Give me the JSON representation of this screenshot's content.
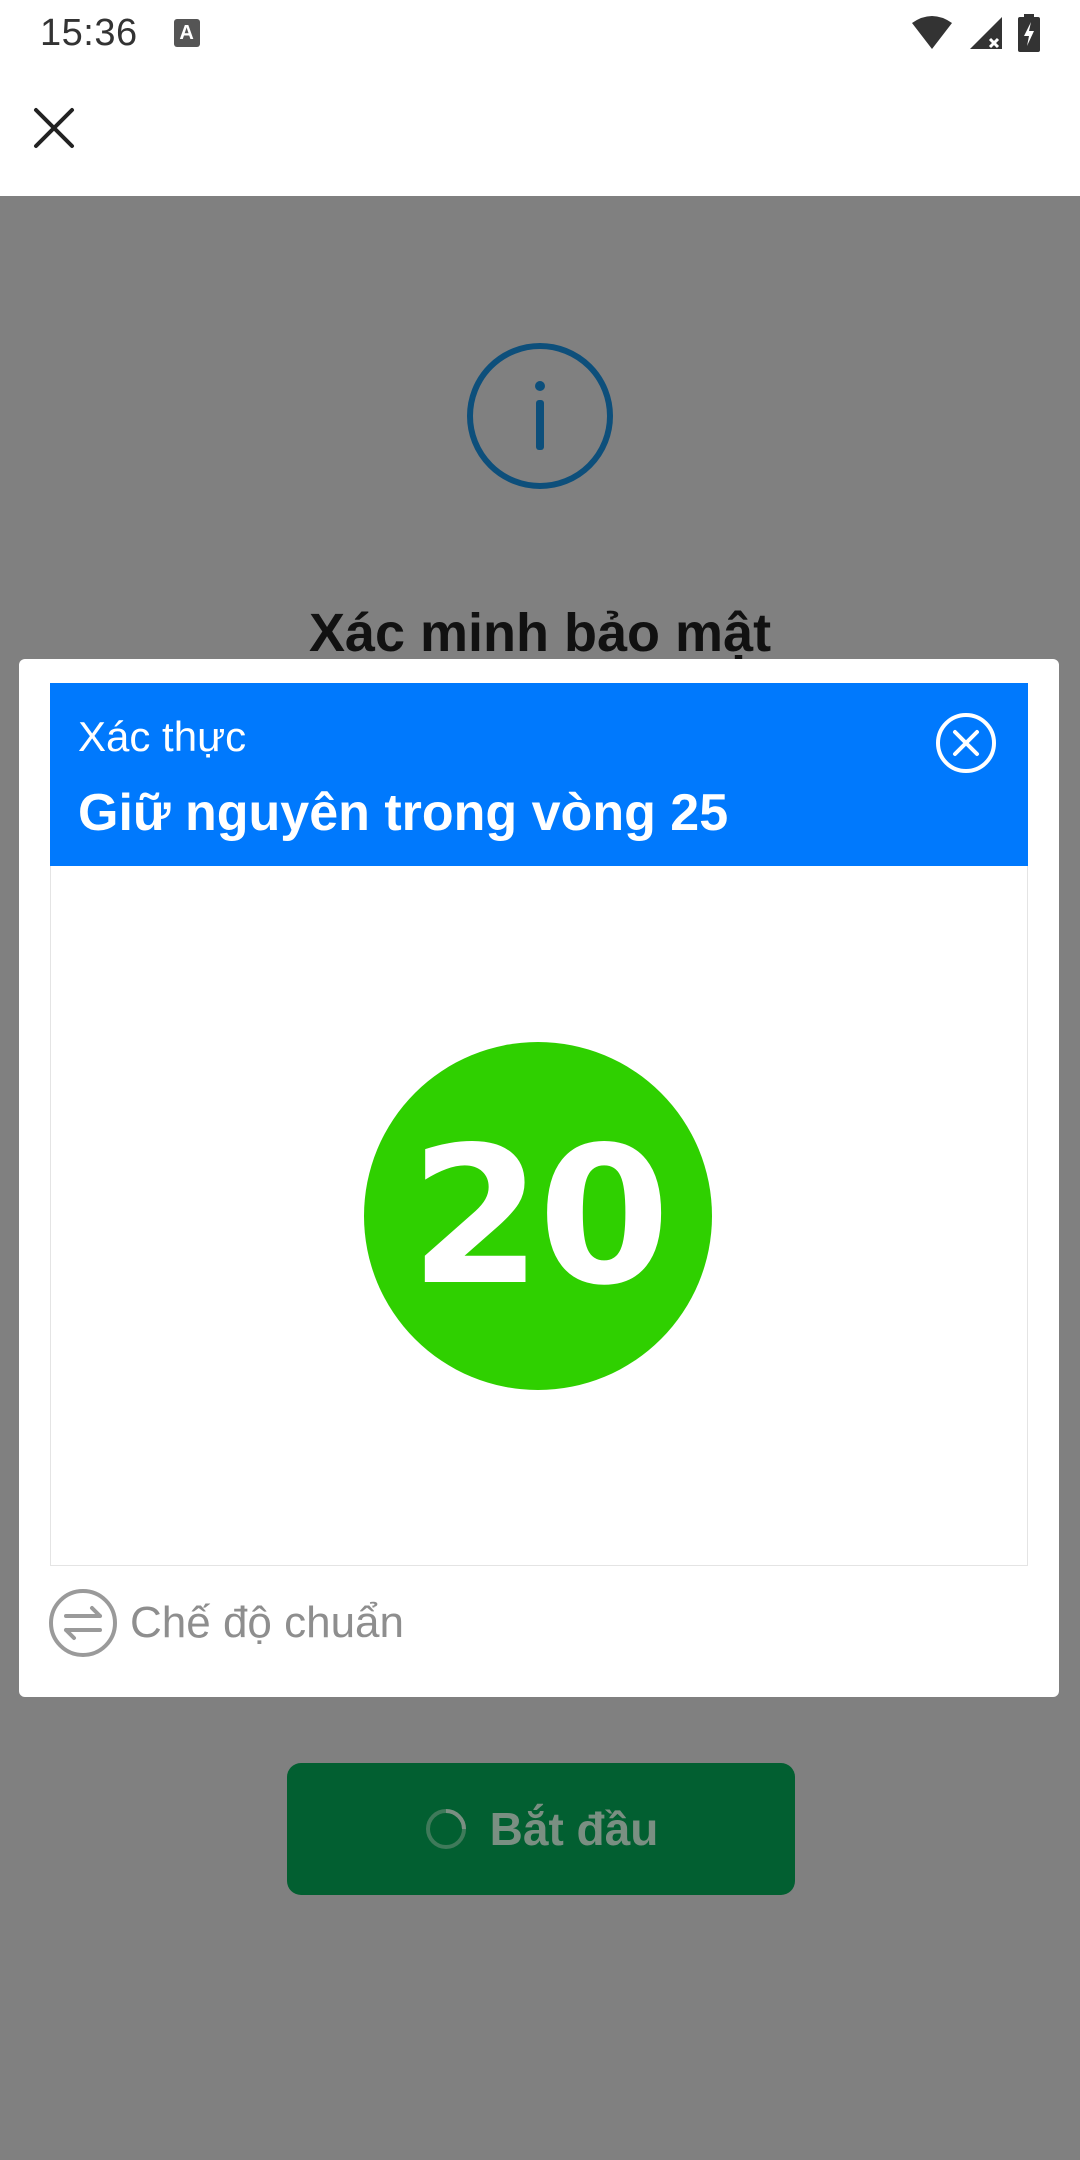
{
  "status_bar": {
    "time": "15:36",
    "notification_icon_letter": "A",
    "icons": [
      "a-notification-icon",
      "wifi-icon",
      "signal-icon",
      "battery-charging-icon"
    ]
  },
  "app_bar": {
    "close_icon": "close-icon"
  },
  "background": {
    "title": "Xác minh bảo mật",
    "start_button_label": "Bắt đầu",
    "info_icon": "info-icon"
  },
  "modal": {
    "subtitle": "Xác thực",
    "title": "Giữ nguyên trong vòng 25",
    "countdown_value": "20",
    "mode_label": "Chế độ chuẩn",
    "colors": {
      "header": "#0079fd",
      "countdown": "#2fd000",
      "start_button": "#025f31",
      "overlay": "#808080"
    }
  }
}
